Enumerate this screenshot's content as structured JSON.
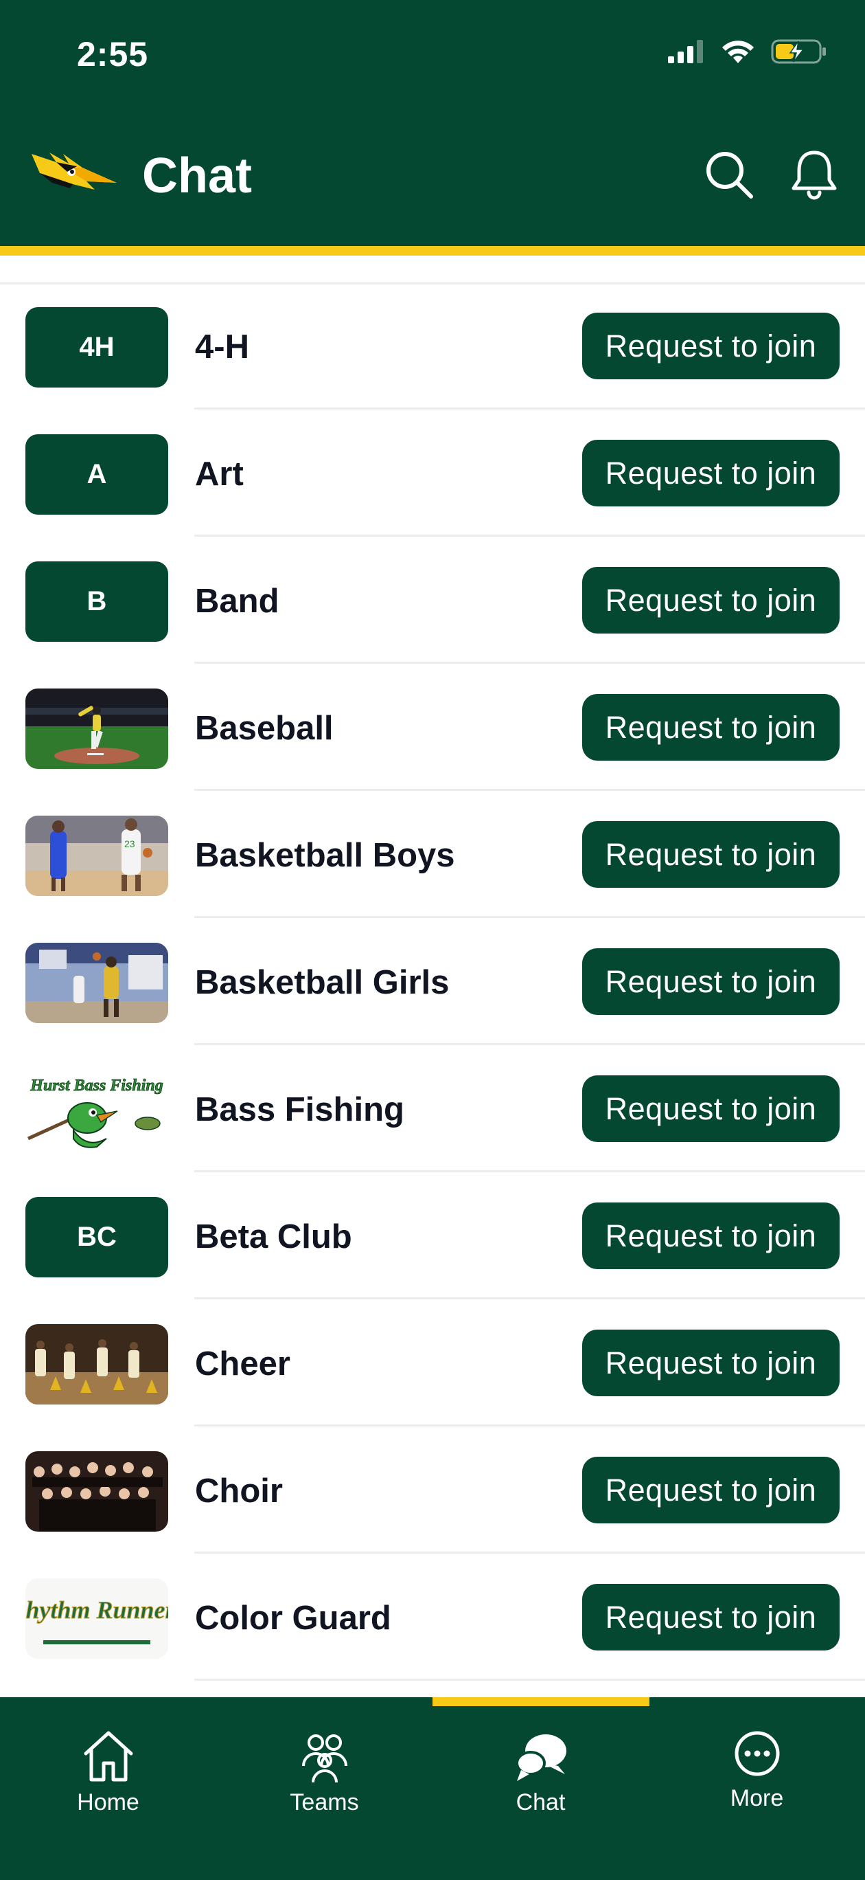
{
  "status_bar": {
    "time": "2:55"
  },
  "header": {
    "title": "Chat"
  },
  "groups": [
    {
      "name": "4-H",
      "initials": "4H",
      "thumb": "initials",
      "action": "Request to join"
    },
    {
      "name": "Art",
      "initials": "A",
      "thumb": "initials",
      "action": "Request to join"
    },
    {
      "name": "Band",
      "initials": "B",
      "thumb": "initials",
      "action": "Request to join"
    },
    {
      "name": "Baseball",
      "thumb": "baseball-photo",
      "action": "Request to join"
    },
    {
      "name": "Basketball Boys",
      "thumb": "basketball-boys-photo",
      "action": "Request to join"
    },
    {
      "name": "Basketball Girls",
      "thumb": "basketball-girls-photo",
      "action": "Request to join"
    },
    {
      "name": "Bass Fishing",
      "thumb": "bass-fishing-logo",
      "action": "Request to join",
      "logo_text": "Hurst Bass Fishing"
    },
    {
      "name": "Beta Club",
      "initials": "BC",
      "thumb": "initials",
      "action": "Request to join"
    },
    {
      "name": "Cheer",
      "thumb": "cheer-photo",
      "action": "Request to join"
    },
    {
      "name": "Choir",
      "thumb": "choir-photo",
      "action": "Request to join"
    },
    {
      "name": "Color Guard",
      "thumb": "color-guard-logo",
      "action": "Request to join",
      "logo_text": "Rhythm Runners"
    }
  ],
  "nav": {
    "active": "Chat",
    "items": [
      {
        "label": "Home",
        "icon": "home-icon"
      },
      {
        "label": "Teams",
        "icon": "teams-icon"
      },
      {
        "label": "Chat",
        "icon": "chat-icon"
      },
      {
        "label": "More",
        "icon": "more-icon"
      }
    ]
  },
  "colors": {
    "primary": "#054831",
    "accent": "#f6ca16",
    "text": "#111521",
    "divider": "#ececec"
  }
}
